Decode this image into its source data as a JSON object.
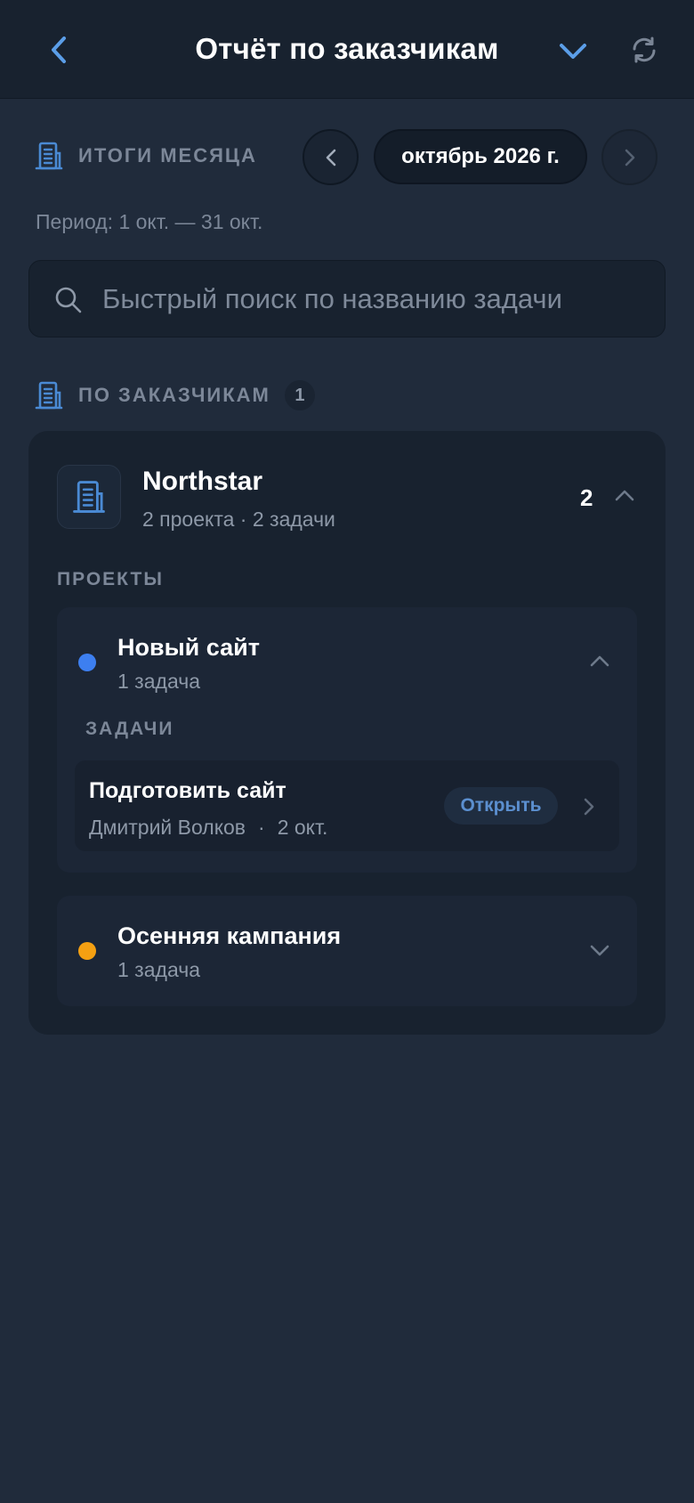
{
  "header": {
    "title": "Отчёт по заказчикам",
    "back_icon": "chevron-left-icon",
    "dropdown_icon": "chevron-down-icon",
    "refresh_icon": "refresh-icon"
  },
  "summary": {
    "label": "ИТОГИ МЕСЯЦА",
    "icon": "building-icon",
    "month": "октябрь 2026 г.",
    "period": "Период: 1 окт. — 31 окт."
  },
  "search": {
    "placeholder": "Быстрый поиск по названию задачи",
    "value": ""
  },
  "clients_section": {
    "label": "ПО ЗАКАЗЧИКАМ",
    "count": "1"
  },
  "clients": [
    {
      "name": "Northstar",
      "meta": "2 проекта · 2 задачи",
      "count": "2",
      "projects_label": "ПРОЕКТЫ",
      "projects": [
        {
          "name": "Новый сайт",
          "meta": "1 задача",
          "color": "#3d7ff0",
          "expanded": true,
          "tasks_label": "ЗАДАЧИ",
          "tasks": [
            {
              "name": "Подготовить сайт",
              "assignee": "Дмитрий Волков",
              "separator": "·",
              "date": "2 окт.",
              "open_label": "Открыть"
            }
          ]
        },
        {
          "name": "Осенняя кампания",
          "meta": "1 задача",
          "color": "#f5a012",
          "expanded": false
        }
      ]
    }
  ],
  "colors": {
    "accent": "#5b9ee8",
    "background": "#202b3b",
    "card": "#18222f"
  }
}
